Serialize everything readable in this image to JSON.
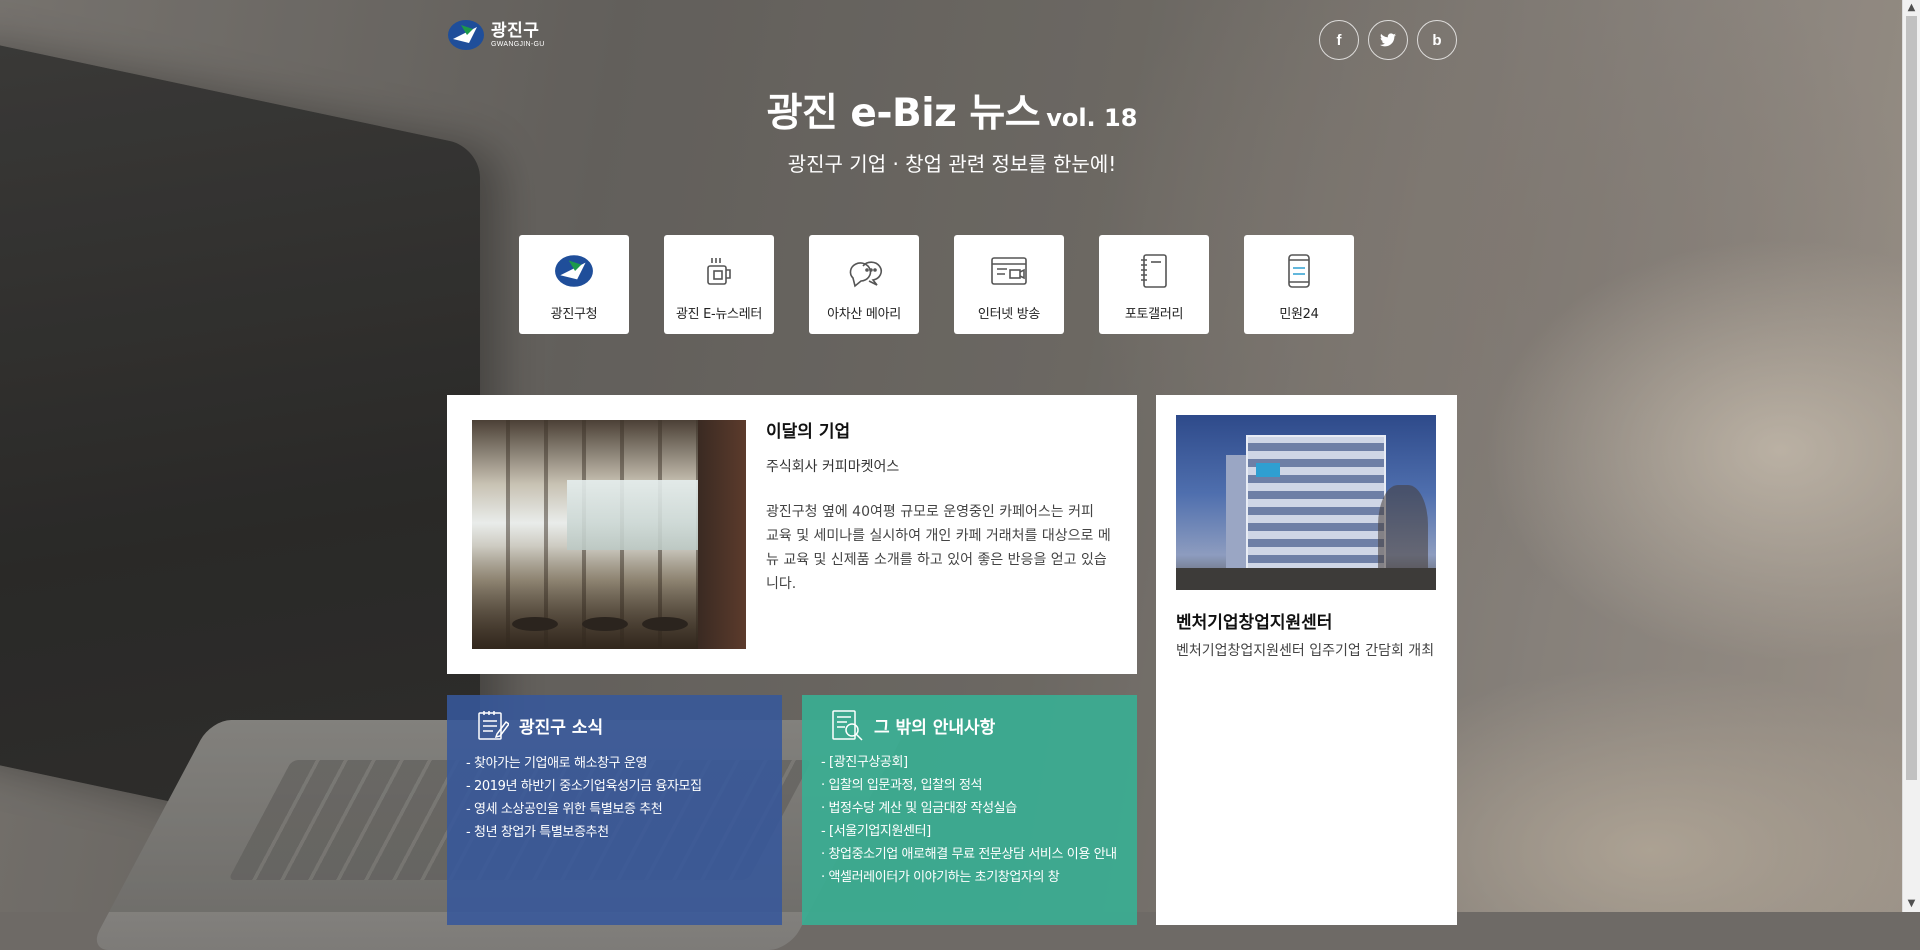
{
  "header": {
    "logo_ko": "광진구",
    "logo_en": "GWANGJIN-GU",
    "title": "광진 e-Biz 뉴스",
    "vol": "vol. 18",
    "subtitle": "광진구 기업 · 창업 관련 정보를 한눈에!",
    "social": [
      {
        "label": "f",
        "icon": "facebook-icon"
      },
      {
        "label": "twitter",
        "icon": "twitter-icon"
      },
      {
        "label": "b",
        "icon": "blog-icon"
      }
    ]
  },
  "quick_links": [
    {
      "label": "광진구청",
      "icon": "gwangjin-logo-icon"
    },
    {
      "label": "광진 E-뉴스레터",
      "icon": "newsletter-icon"
    },
    {
      "label": "아차산 메아리",
      "icon": "speech-bubble-icon"
    },
    {
      "label": "인터넷 방송",
      "icon": "broadcast-icon"
    },
    {
      "label": "포토갤러리",
      "icon": "photo-album-icon"
    },
    {
      "label": "민원24",
      "icon": "mobile-icon"
    }
  ],
  "feature": {
    "title": "이달의 기업",
    "company": "주식회사 커피마켓어스",
    "description": "광진구청 옆에 40여평 규모로 운영중인 카페어스는 커피 교육 및 세미나를 실시하여 개인 카페 거래처를 대상으로 메뉴 교육 및 신제품 소개를 하고 있어 좋은 반응을 얻고 있습니다."
  },
  "side": {
    "title": "벤처기업창업지원센터",
    "description": "벤처기업창업지원센터 입주기업 간담회 개최"
  },
  "news": {
    "title": "광진구 소식",
    "items": [
      "- 찾아가는 기업애로 해소창구 운영",
      "- 2019년 하반기 중소기업육성기금 융자모집",
      "- 영세 소상공인을 위한 특별보증 추천",
      "- 청년 창업가 특별보증추천"
    ]
  },
  "notices": {
    "title": "그 밖의 안내사항",
    "items": [
      "- [광진구상공회]",
      "· 입찰의 입문과정, 입찰의 정석",
      "· 법정수당 계산 및 임금대장 작성실습",
      "- [서울기업지원센터]",
      "· 창업중소기업 애로해결 무료 전문상담 서비스 이용 안내",
      "· 액셀러레이터가 이야기하는 초기창업자의 창"
    ]
  },
  "colors": {
    "news_bg": "#37589b",
    "notice_bg": "#3aae93",
    "card_bg": "#ffffff"
  }
}
